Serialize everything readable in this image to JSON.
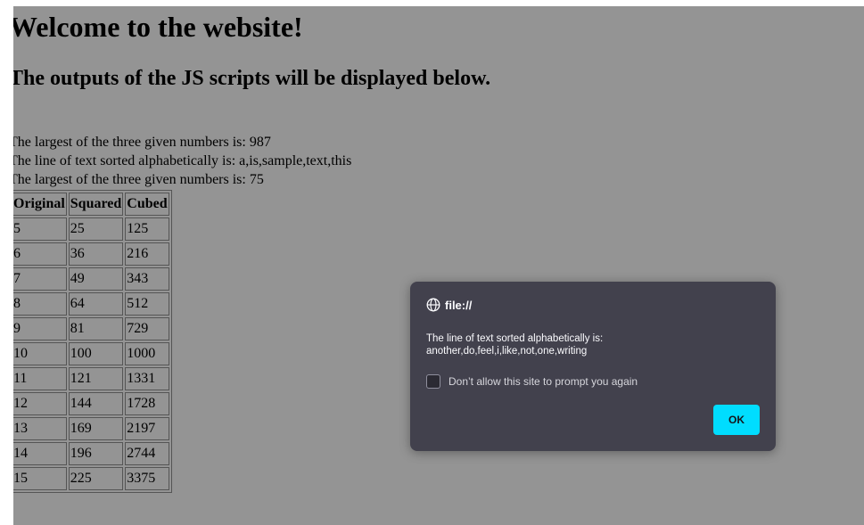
{
  "page": {
    "heading1": "Welcome to the website!",
    "heading2": "The outputs of the JS scripts will be displayed below.",
    "outputs": [
      "The largest of the three given numbers is: 987",
      "The line of text sorted alphabetically is: a,is,sample,text,this",
      "The largest of the three given numbers is: 75"
    ],
    "table": {
      "headers": [
        "Original",
        "Squared",
        "Cubed"
      ],
      "rows": [
        [
          "5",
          "25",
          "125"
        ],
        [
          "6",
          "36",
          "216"
        ],
        [
          "7",
          "49",
          "343"
        ],
        [
          "8",
          "64",
          "512"
        ],
        [
          "9",
          "81",
          "729"
        ],
        [
          "10",
          "100",
          "1000"
        ],
        [
          "11",
          "121",
          "1331"
        ],
        [
          "12",
          "144",
          "1728"
        ],
        [
          "13",
          "169",
          "2197"
        ],
        [
          "14",
          "196",
          "2744"
        ],
        [
          "15",
          "225",
          "3375"
        ]
      ]
    }
  },
  "dialog": {
    "origin": "file://",
    "message_line1": "The line of text sorted alphabetically is:",
    "message_line2": "another,do,feel,i,like,not,one,writing",
    "checkbox_label": "Don’t allow this site to prompt you again",
    "ok_label": "OK",
    "icon": "globe-icon"
  },
  "colors": {
    "overlay": "#949494",
    "dialog_bg": "#42414d",
    "ok_button": "#00ddff"
  }
}
